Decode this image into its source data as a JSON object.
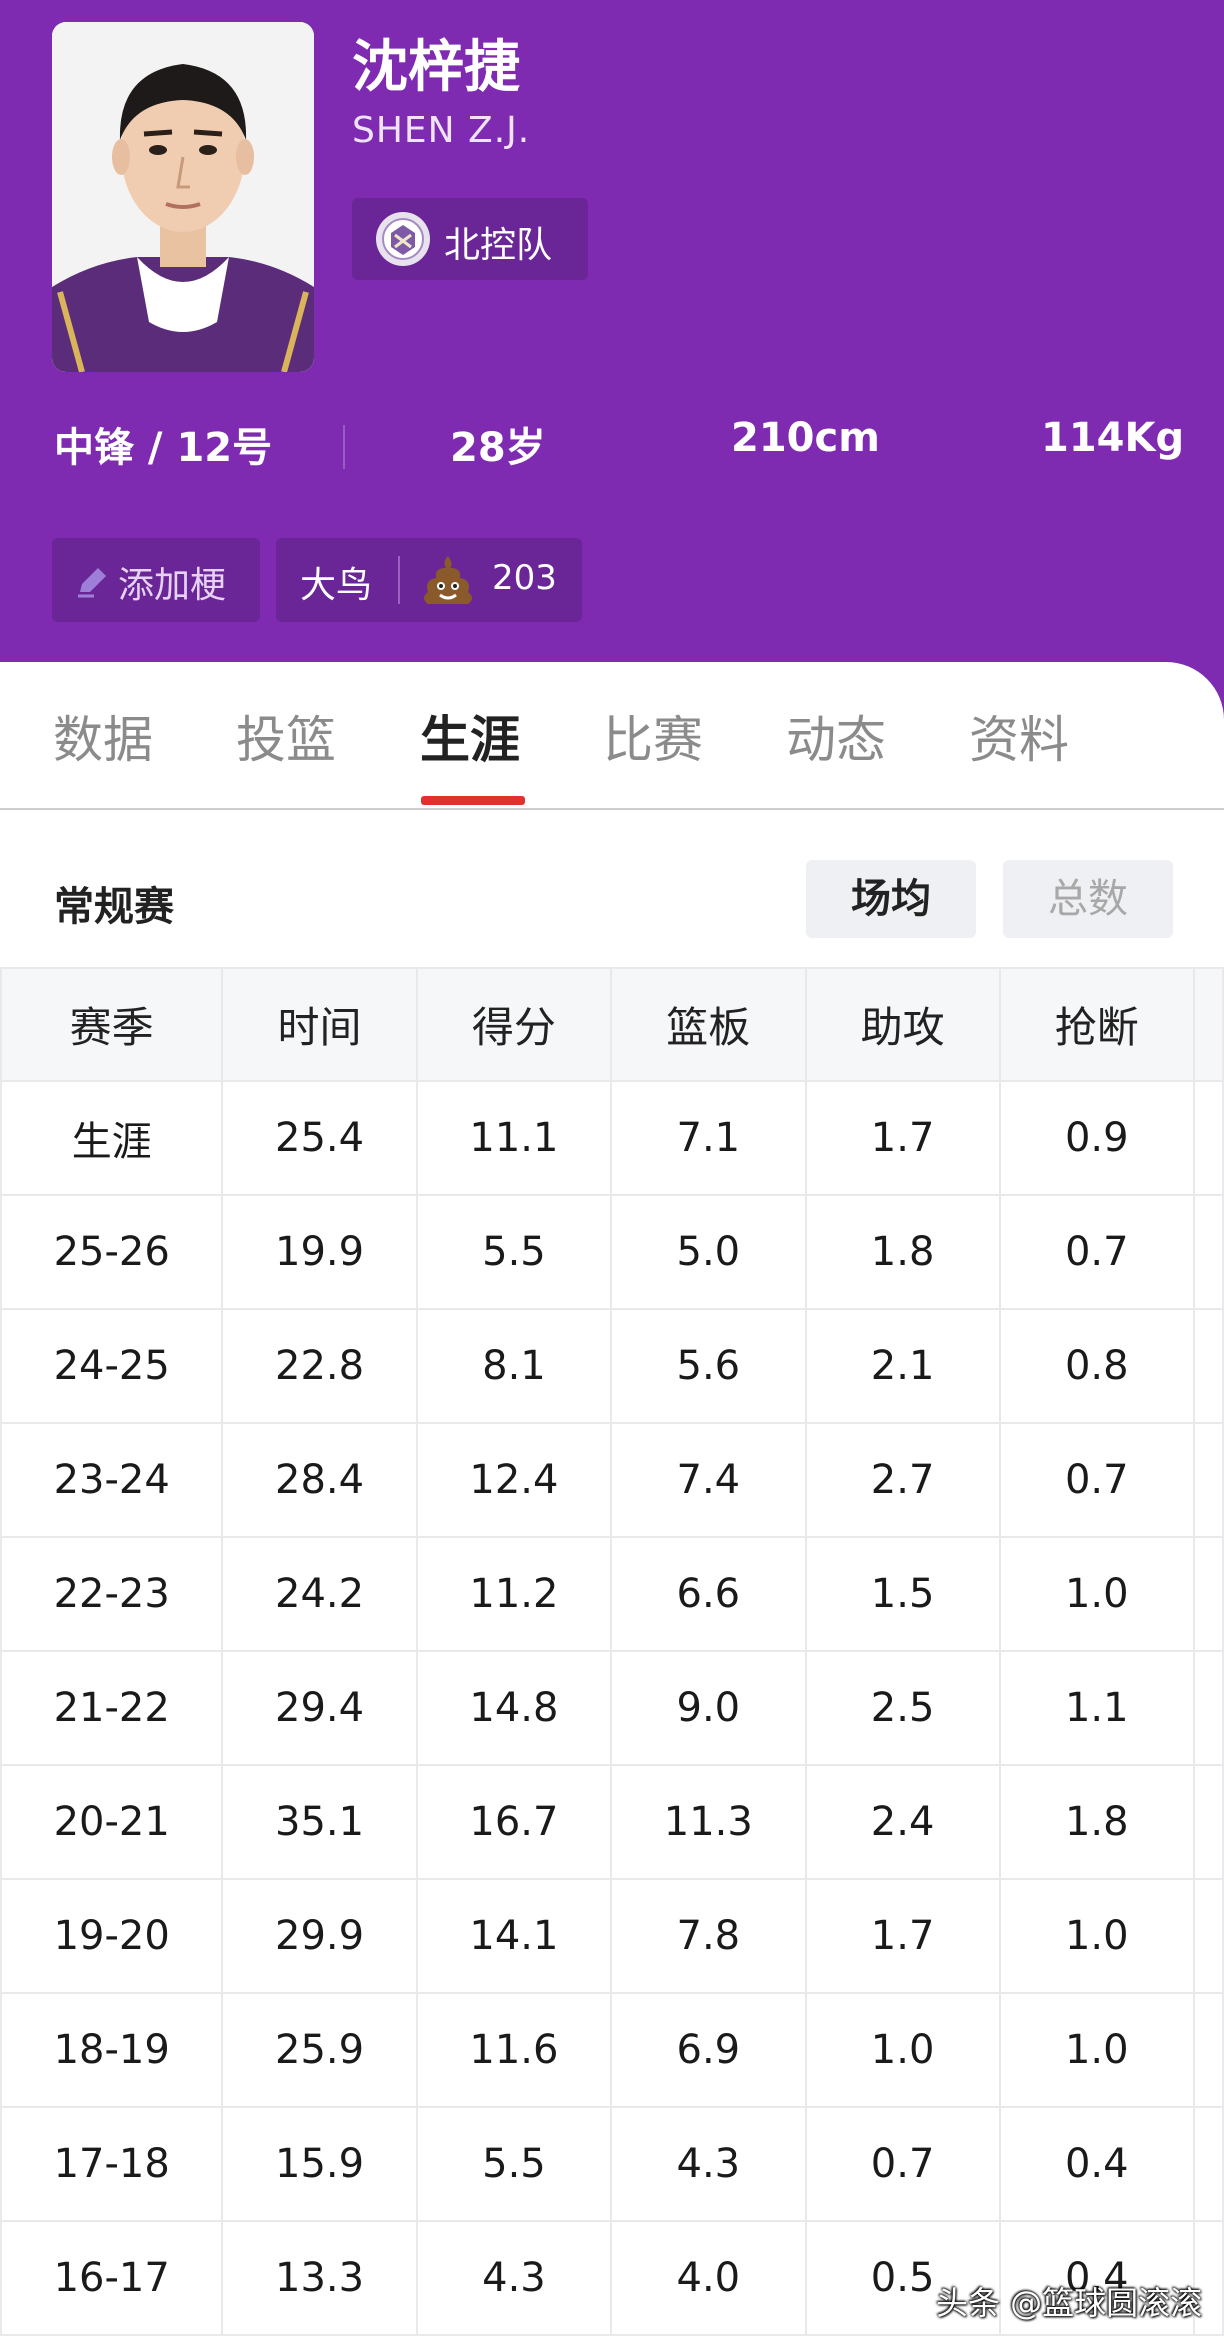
{
  "player": {
    "name_cn": "沈梓捷",
    "name_en": "SHEN Z.J.",
    "team": "北控队",
    "position": "中锋 / 12号",
    "age": "28岁",
    "height": "210cm",
    "weight": "114Kg"
  },
  "chips": {
    "add_label": "添加梗",
    "nickname": "大鸟",
    "nickname_count": "203"
  },
  "tabs": [
    {
      "label": "数据",
      "active": false
    },
    {
      "label": "投篮",
      "active": false
    },
    {
      "label": "生涯",
      "active": true
    },
    {
      "label": "比赛",
      "active": false
    },
    {
      "label": "动态",
      "active": false
    },
    {
      "label": "资料",
      "active": false
    }
  ],
  "section": {
    "title": "常规赛",
    "toggle_avg": "场均",
    "toggle_total": "总数"
  },
  "table": {
    "headers": [
      "赛季",
      "时间",
      "得分",
      "篮板",
      "助攻",
      "抢断"
    ],
    "rows": [
      [
        "生涯",
        "25.4",
        "11.1",
        "7.1",
        "1.7",
        "0.9"
      ],
      [
        "25-26",
        "19.9",
        "5.5",
        "5.0",
        "1.8",
        "0.7"
      ],
      [
        "24-25",
        "22.8",
        "8.1",
        "5.6",
        "2.1",
        "0.8"
      ],
      [
        "23-24",
        "28.4",
        "12.4",
        "7.4",
        "2.7",
        "0.7"
      ],
      [
        "22-23",
        "24.2",
        "11.2",
        "6.6",
        "1.5",
        "1.0"
      ],
      [
        "21-22",
        "29.4",
        "14.8",
        "9.0",
        "2.5",
        "1.1"
      ],
      [
        "20-21",
        "35.1",
        "16.7",
        "11.3",
        "2.4",
        "1.8"
      ],
      [
        "19-20",
        "29.9",
        "14.1",
        "7.8",
        "1.7",
        "1.0"
      ],
      [
        "18-19",
        "25.9",
        "11.6",
        "6.9",
        "1.0",
        "1.0"
      ],
      [
        "17-18",
        "15.9",
        "5.5",
        "4.3",
        "0.7",
        "0.4"
      ],
      [
        "16-17",
        "13.3",
        "4.3",
        "4.0",
        "0.5",
        "0.4"
      ]
    ]
  },
  "watermark": "头条 @篮球圆滚滚",
  "colors": {
    "header_bg": "#7e2bb1",
    "chip_bg": "#6a2596",
    "tab_active_underline": "#e0312d"
  },
  "icons": [
    "player-photo",
    "team-logo-icon",
    "pencil-icon",
    "poop-emoji-icon"
  ]
}
